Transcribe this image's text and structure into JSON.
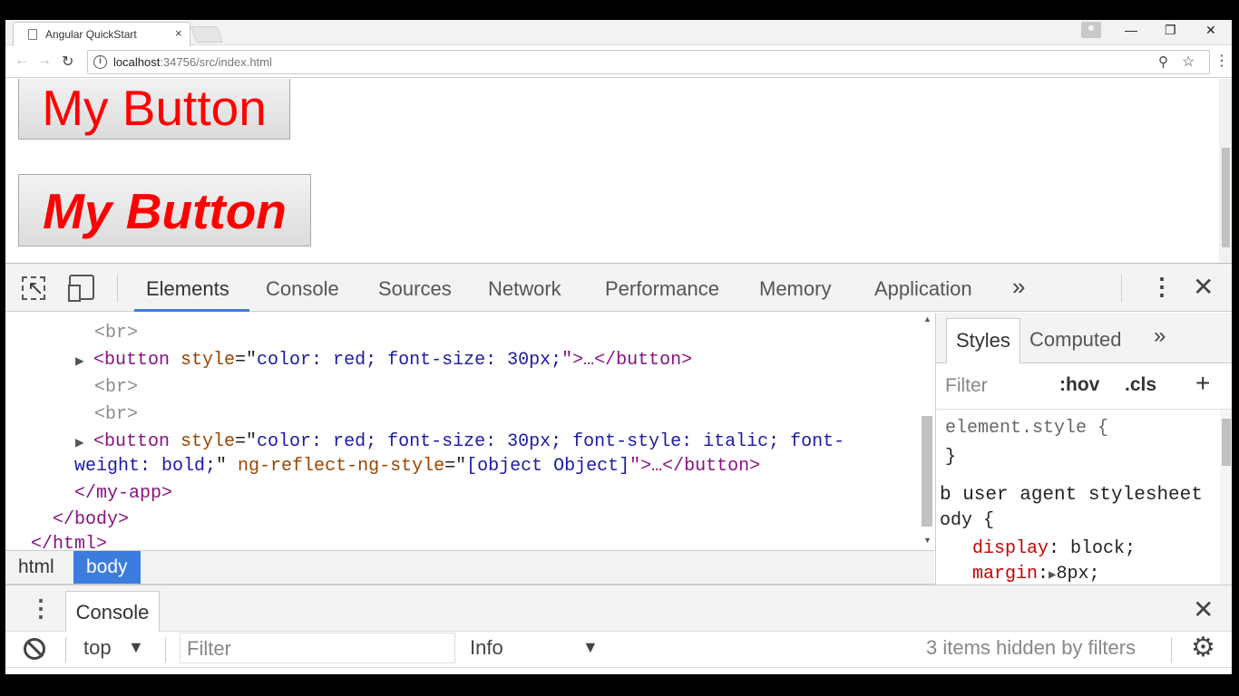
{
  "browser": {
    "tab_title": "Angular QuickStart",
    "tab_close": "×",
    "window_controls": {
      "minimize": "—",
      "restore": "❐",
      "close": "✕"
    },
    "nav": {
      "back": "←",
      "forward": "→",
      "reload": "↻"
    },
    "address": {
      "info": "i",
      "host": "localhost",
      "rest": ":34756/src/index.html"
    },
    "zoom_icon": "⚲",
    "star_icon": "☆",
    "menu_icon": "⋮"
  },
  "page": {
    "button1_label": "My Button",
    "button2_label": "My Button",
    "text_color": "#ff0000"
  },
  "devtools": {
    "tabs": [
      "Elements",
      "Console",
      "Sources",
      "Network",
      "Performance",
      "Memory",
      "Application"
    ],
    "active_tab": "Elements",
    "more": "»",
    "kebab": "⋮",
    "close": "✕",
    "tree": {
      "br1": "<br>",
      "button1": {
        "open": "<button ",
        "attr": "style",
        "eq": "=\"",
        "value": "color: red; font-size: 30px;",
        "close": "\">…</button>"
      },
      "br2": "<br>",
      "br3": "<br>",
      "button2": {
        "open": "<button ",
        "attr": "style",
        "eq": "=\"",
        "value_line1": "color: red; font-size: 30px; font-style: italic; font-",
        "value_line2": "weight: bold;",
        "sep": "\" ",
        "attr2": "ng-reflect-ng-style",
        "eq2": "=\"",
        "value2": "[object Object]",
        "close": "\">…</button>"
      },
      "close_myapp": "</my-app>",
      "close_body": "</body>",
      "close_html": "</html>"
    },
    "breadcrumbs": [
      "html",
      "body"
    ],
    "selected_crumb": "body",
    "styles": {
      "tabs": [
        "Styles",
        "Computed"
      ],
      "active": "Styles",
      "more": "»",
      "filter_placeholder": "Filter",
      "hov": ":hov",
      "cls": ".cls",
      "add": "+",
      "element_style_open": "element.style {",
      "element_style_close": "}",
      "ua_line1": "b user agent stylesheet",
      "ua_line2": "ody {",
      "prop1_name": "display",
      "prop1_value": " block;",
      "prop2_name": "margin",
      "prop2_value": "8px;",
      "prop_sep": ":"
    },
    "drawer": {
      "kebab": "⋮",
      "tab": "Console",
      "close": "✕",
      "context": "top",
      "filter_placeholder": "Filter",
      "level": "Info",
      "hidden_message": "3 items hidden by filters",
      "dropdown_arrow": "▼",
      "gear": "⚙"
    }
  }
}
